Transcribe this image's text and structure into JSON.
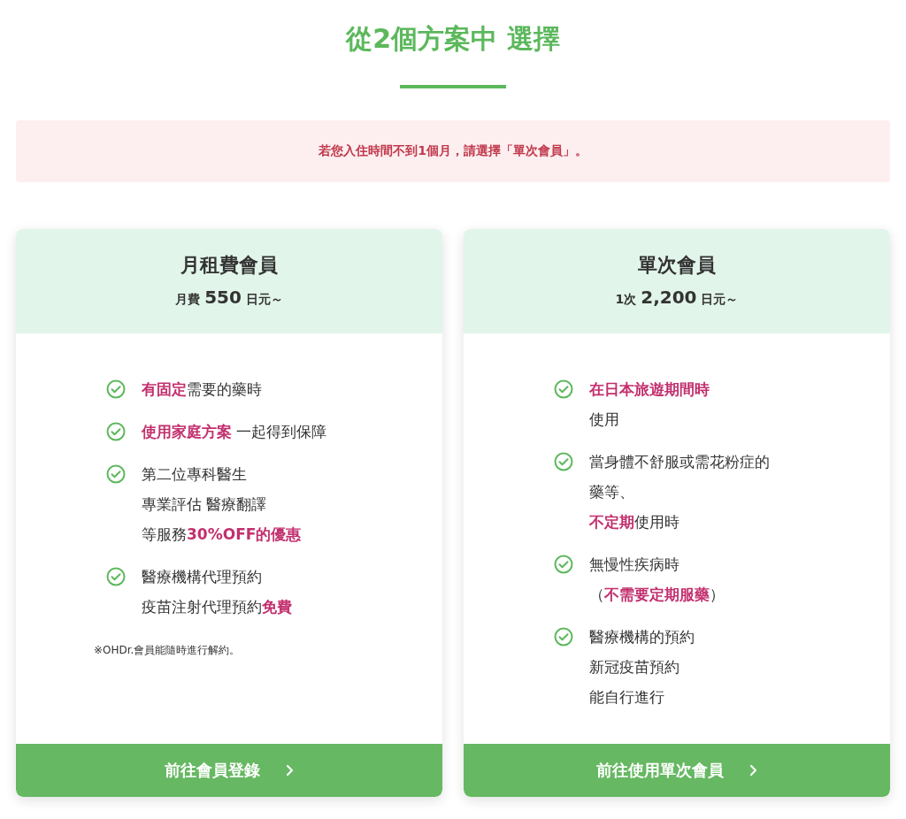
{
  "heading": "從2個方案中 選擇",
  "notice": "若您入住時間不到1個月，請選擇「單次會員」。",
  "plans": [
    {
      "title": "月租費會員",
      "price": "月費 **550** 日元～",
      "features": [
        {
          "lines": [
            "**有固定**需要的藥時"
          ]
        },
        {
          "lines": [
            "**使用家庭方案** 一起得到保障"
          ]
        },
        {
          "lines": [
            "第二位專科醫生",
            "專業評估 醫療翻譯",
            "等服務**30%OFF的優惠**"
          ]
        },
        {
          "lines": [
            "醫療機構代理預約",
            "疫苗注射代理預約**免費**"
          ]
        }
      ],
      "note": "※OHDr.會員能隨時進行解約。",
      "button": "前往會員登錄"
    },
    {
      "title": "單次會員",
      "price": "1次 **2,200** 日元～",
      "features": [
        {
          "lines": [
            "**在日本旅遊期間時**",
            "使用"
          ]
        },
        {
          "lines": [
            "當身體不舒服或需花粉症的",
            "藥等、",
            "**不定期**使用時"
          ]
        },
        {
          "lines": [
            "無慢性疾病時",
            "（**不需要定期服藥**）"
          ]
        },
        {
          "lines": [
            "醫療機構的預約",
            "新冠疫苗預約",
            "能自行進行"
          ]
        }
      ],
      "button": "前往使用單次會員"
    }
  ]
}
